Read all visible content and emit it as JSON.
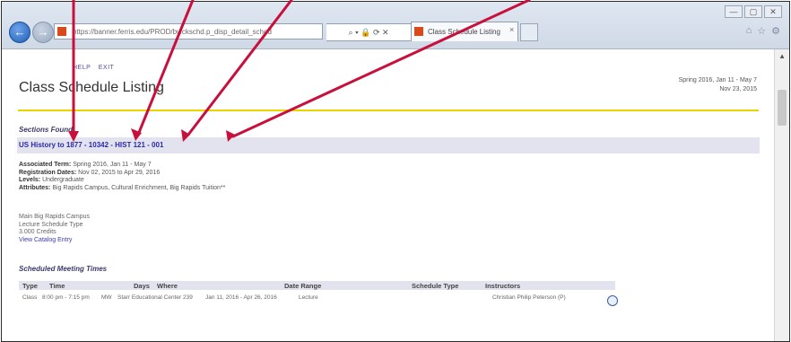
{
  "browser": {
    "address": "https://banner.ferris.edu/PROD/bwckschd.p_disp_detail_sched",
    "address_tools": "⌕ ▾ 🔒 ⟳ ✕",
    "tab_title": "Class Schedule Listing",
    "tab_close": "×",
    "window_controls": [
      "—",
      "▢",
      "✕"
    ],
    "chrome_icons": [
      "⌂",
      "☆",
      "⚙"
    ]
  },
  "page": {
    "help_label": "HELP",
    "exit_label": "EXIT",
    "title": "Class Schedule Listing",
    "term_line1": "Spring 2016, Jan 11 - May 7",
    "term_line2": "Nov 23, 2015",
    "sections_found": "Sections Found",
    "section_link": "US History to 1877 - 10342 - HIST 121 - 001",
    "associated_term_label": "Associated Term:",
    "associated_term_value": "Spring 2016, Jan 11 - May 7",
    "registration_dates_label": "Registration Dates:",
    "registration_dates_value": "Nov 02, 2015 to Apr 29, 2016",
    "levels_label": "Levels:",
    "levels_value": "Undergraduate",
    "attributes_label": "Attributes:",
    "attributes_value": "Big Rapids Campus, Cultural Enrichment, Big Rapids Tuition**",
    "campus": "Main Big Rapids Campus",
    "schedule_type": "Lecture Schedule Type",
    "credits": "3.000 Credits",
    "catalog_link": "View Catalog Entry",
    "meeting_title": "Scheduled Meeting Times",
    "meeting_headers": [
      "Type",
      "Time",
      "Days",
      "Where",
      "Date Range",
      "Schedule Type",
      "Instructors"
    ],
    "meeting_row": {
      "type": "Class",
      "time": "8:00 pm - 7:15 pm",
      "days": "MW",
      "where": "Starr Educational Center 239",
      "date_range": "Jan 11, 2016 - Apr 26, 2016",
      "schedule_type": "Lecture",
      "instructor": "Christian Philip Peterson (P)"
    }
  },
  "annotation_color": "#c8103c"
}
